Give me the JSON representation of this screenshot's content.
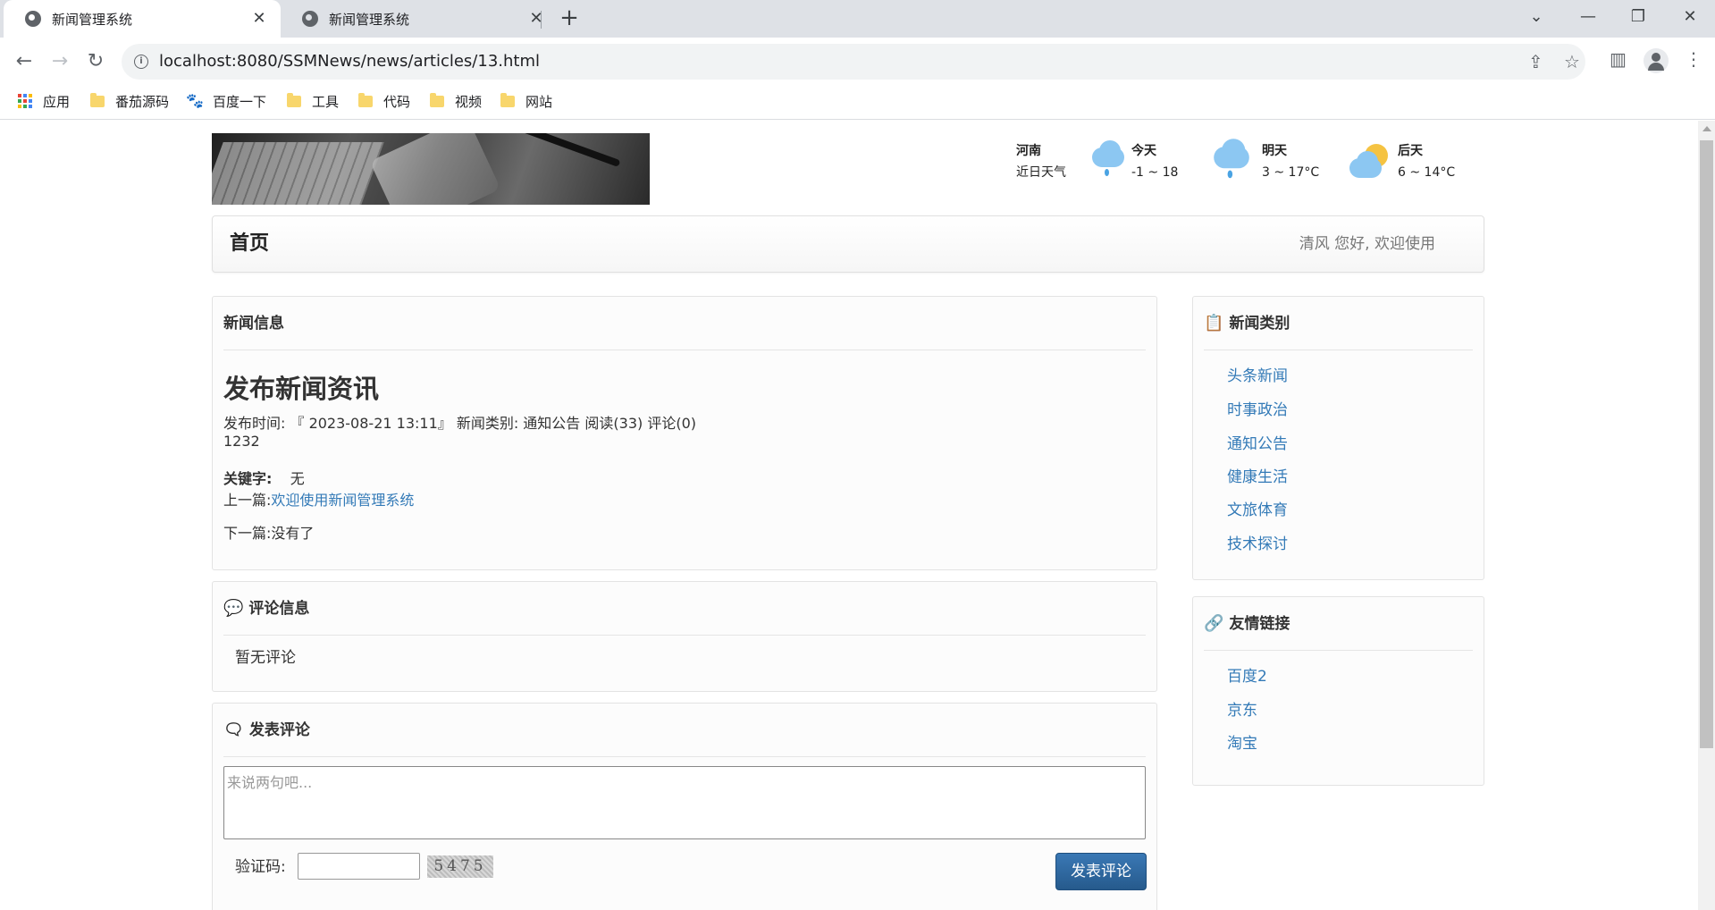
{
  "browser": {
    "tabs": [
      {
        "title": "新闻管理系统",
        "active": true
      },
      {
        "title": "新闻管理系统",
        "active": false
      }
    ],
    "url": "localhost:8080/SSMNews/news/articles/13.html",
    "bookmarks": [
      "应用",
      "番茄源码",
      "百度一下",
      "工具",
      "代码",
      "视频",
      "网站"
    ]
  },
  "weather": {
    "region": "河南",
    "region_sub": "近日天气",
    "days": [
      {
        "label": "今天",
        "temp": "-1 ~ 18",
        "icon": "rain-cloud-icon"
      },
      {
        "label": "明天",
        "temp": "3 ~ 17°C",
        "icon": "rain-cloud-icon"
      },
      {
        "label": "后天",
        "temp": "6 ~ 14°C",
        "icon": "partly-cloudy-icon"
      }
    ]
  },
  "navbar": {
    "brand": "首页",
    "greeting": "清风 您好, 欢迎使用"
  },
  "article_panel": {
    "heading": "新闻信息",
    "title": "发布新闻资讯",
    "meta": "发布时间: 『 2023-08-21 13:11』 新闻类别: 通知公告  阅读(33) 评论(0)",
    "body": "1232",
    "keyword_label": "关键字:",
    "keyword_value": "无",
    "prev_label": "上一篇:",
    "prev_link": "欢迎使用新闻管理系统",
    "next_label": "下一篇:",
    "next_value": "没有了"
  },
  "comments_panel": {
    "heading": "评论信息",
    "empty_text": "暂无评论"
  },
  "post_comment": {
    "heading": "发表评论",
    "placeholder": "来说两句吧...",
    "captcha_label": "验证码:",
    "captcha_code": "5475",
    "submit_label": "发表评论"
  },
  "categories": {
    "heading": "新闻类别",
    "items": [
      "头条新闻",
      "时事政治",
      "通知公告",
      "健康生活",
      "文旅体育",
      "技术探讨"
    ]
  },
  "links": {
    "heading": "友情链接",
    "items": [
      "百度2",
      "京东",
      "淘宝"
    ]
  }
}
